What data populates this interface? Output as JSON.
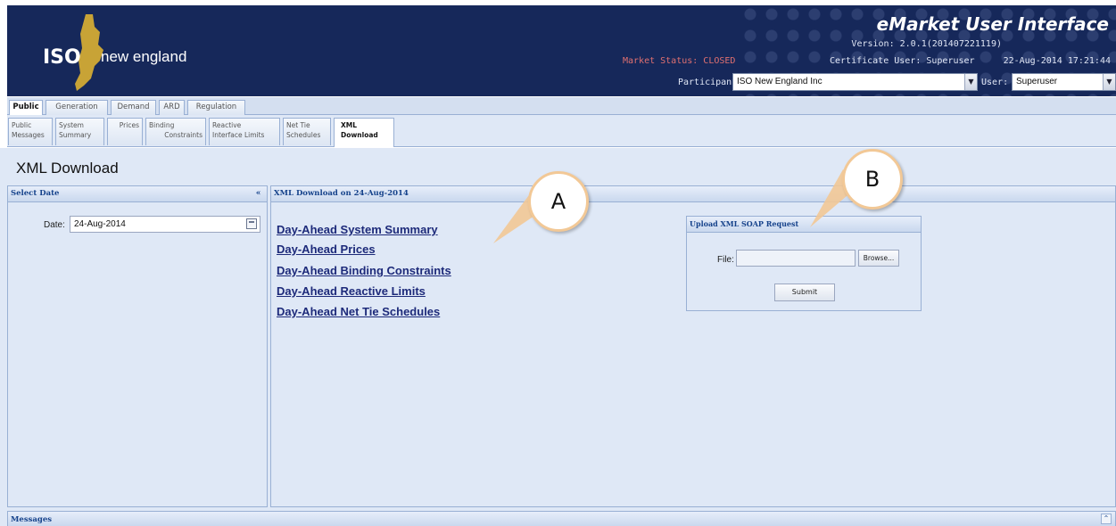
{
  "header": {
    "logo_iso": "ISO",
    "logo_ne": "new england",
    "app_title": "eMarket User Interface",
    "version": "Version: 2.0.1(201407221119)",
    "market_status": "Market Status: CLOSED",
    "certificate_user": "Certificate User: Superuser",
    "datetime": "22-Aug-2014 17:21:44",
    "participant_label": "Participant:",
    "participant_value": "ISO New England Inc",
    "user_label": "User:",
    "user_value": "Superuser"
  },
  "tabs_main": [
    "Public",
    "Generation",
    "Demand",
    "ARD",
    "Regulation"
  ],
  "tabs_sub": [
    {
      "line1": "Public",
      "line2": "Messages"
    },
    {
      "line1": "System",
      "line2": "Summary"
    },
    {
      "line1": "Prices",
      "line2": ""
    },
    {
      "line1": "Binding",
      "line2": "Constraints"
    },
    {
      "line1": "Reactive",
      "line2": "Interface Limits"
    },
    {
      "line1": "Net Tie",
      "line2": "Schedules"
    },
    {
      "line1": "XML",
      "line2": "Download"
    }
  ],
  "page_title": "XML Download",
  "left_panel": {
    "title": "Select Date",
    "collapse_glyph": "«",
    "date_label": "Date:",
    "date_value": "24-Aug-2014"
  },
  "main_panel": {
    "title": "XML Download on 24-Aug-2014",
    "links": [
      "Day-Ahead System Summary",
      "Day-Ahead Prices",
      "Day-Ahead Binding Constraints",
      "Day-Ahead Reactive Limits",
      "Day-Ahead Net Tie Schedules"
    ],
    "upload": {
      "title": "Upload XML SOAP Request",
      "file_label": "File:",
      "browse_label": "Browse...",
      "submit_label": "Submit"
    }
  },
  "messages": {
    "title": "Messages",
    "expand_glyph": "⌃"
  },
  "callouts": {
    "a": "A",
    "b": "B"
  },
  "colors": {
    "header_bg": "#16285a",
    "panel_bg": "#dfe8f6",
    "panel_title": "#15428b",
    "link": "#1d2a7a",
    "market_closed": "#e07070",
    "callout_border": "#f2c896"
  },
  "icons": [
    "calendar-icon",
    "collapse-chevrons-icon",
    "dropdown-arrow-icon",
    "expand-icon"
  ]
}
